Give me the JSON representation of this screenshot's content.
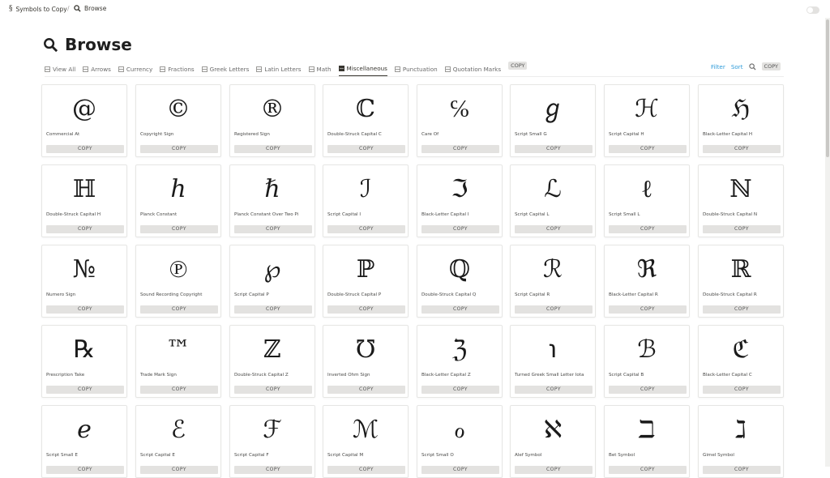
{
  "breadcrumb": {
    "root_symbol": "§",
    "root": "Symbols to Copy",
    "separator": "/",
    "current": "Browse"
  },
  "page": {
    "title": "Browse"
  },
  "tabs": [
    {
      "label": "View All",
      "active": false
    },
    {
      "label": "Arrows",
      "active": false
    },
    {
      "label": "Currency",
      "active": false
    },
    {
      "label": "Fractions",
      "active": false
    },
    {
      "label": "Greek Letters",
      "active": false
    },
    {
      "label": "Latin Letters",
      "active": false
    },
    {
      "label": "Math",
      "active": false
    },
    {
      "label": "Miscellaneous",
      "active": true
    },
    {
      "label": "Punctuation",
      "active": false
    },
    {
      "label": "Quotation Marks",
      "active": false
    }
  ],
  "tabs_copy_label": "COPY",
  "toolbar": {
    "filter": "Filter",
    "sort": "Sort",
    "copy": "COPY"
  },
  "card_copy_label": "COPY",
  "cards": [
    {
      "symbol": "@",
      "name": "Commercial At"
    },
    {
      "symbol": "©",
      "name": "Copyright Sign"
    },
    {
      "symbol": "®",
      "name": "Registered Sign"
    },
    {
      "symbol": "ℂ",
      "name": "Double-Struck Capital C"
    },
    {
      "symbol": "℅",
      "name": "Care Of"
    },
    {
      "symbol": "ℊ",
      "name": "Script Small G"
    },
    {
      "symbol": "ℋ",
      "name": "Script Capital H"
    },
    {
      "symbol": "ℌ",
      "name": "Black-Letter Capital H"
    },
    {
      "symbol": "ℍ",
      "name": "Double-Struck Capital H"
    },
    {
      "symbol": "ℎ",
      "name": "Planck Constant"
    },
    {
      "symbol": "ℏ",
      "name": "Planck Constant Over Two Pi"
    },
    {
      "symbol": "ℐ",
      "name": "Script Capital I"
    },
    {
      "symbol": "ℑ",
      "name": "Black-Letter Capital I"
    },
    {
      "symbol": "ℒ",
      "name": "Script Capital L"
    },
    {
      "symbol": "ℓ",
      "name": "Script Small L"
    },
    {
      "symbol": "ℕ",
      "name": "Double-Struck Capital N"
    },
    {
      "symbol": "№",
      "name": "Numero Sign"
    },
    {
      "symbol": "℗",
      "name": "Sound Recording Copyright"
    },
    {
      "symbol": "℘",
      "name": "Script Capital P"
    },
    {
      "symbol": "ℙ",
      "name": "Double-Struck Capital P"
    },
    {
      "symbol": "ℚ",
      "name": "Double-Struck Capital Q"
    },
    {
      "symbol": "ℛ",
      "name": "Script Capital R"
    },
    {
      "symbol": "ℜ",
      "name": "Black-Letter Capital R"
    },
    {
      "symbol": "ℝ",
      "name": "Double-Struck Capital R"
    },
    {
      "symbol": "℞",
      "name": "Prescription Take"
    },
    {
      "symbol": "™",
      "name": "Trade Mark Sign"
    },
    {
      "symbol": "ℤ",
      "name": "Double-Struck Capital Z"
    },
    {
      "symbol": "℧",
      "name": "Inverted Ohm Sign"
    },
    {
      "symbol": "ℨ",
      "name": "Black-Letter Capital Z"
    },
    {
      "symbol": "℩",
      "name": "Turned Greek Small Letter Iota"
    },
    {
      "symbol": "ℬ",
      "name": "Script Capital B"
    },
    {
      "symbol": "ℭ",
      "name": "Black-Letter Capital C"
    },
    {
      "symbol": "ℯ",
      "name": "Script Small E"
    },
    {
      "symbol": "ℰ",
      "name": "Script Capital E"
    },
    {
      "symbol": "ℱ",
      "name": "Script Capital F"
    },
    {
      "symbol": "ℳ",
      "name": "Script Capital M"
    },
    {
      "symbol": "ℴ",
      "name": "Script Small O"
    },
    {
      "symbol": "ℵ",
      "name": "Alef Symbol"
    },
    {
      "symbol": "ℶ",
      "name": "Bet Symbol"
    },
    {
      "symbol": "ℷ",
      "name": "Gimel Symbol"
    }
  ]
}
